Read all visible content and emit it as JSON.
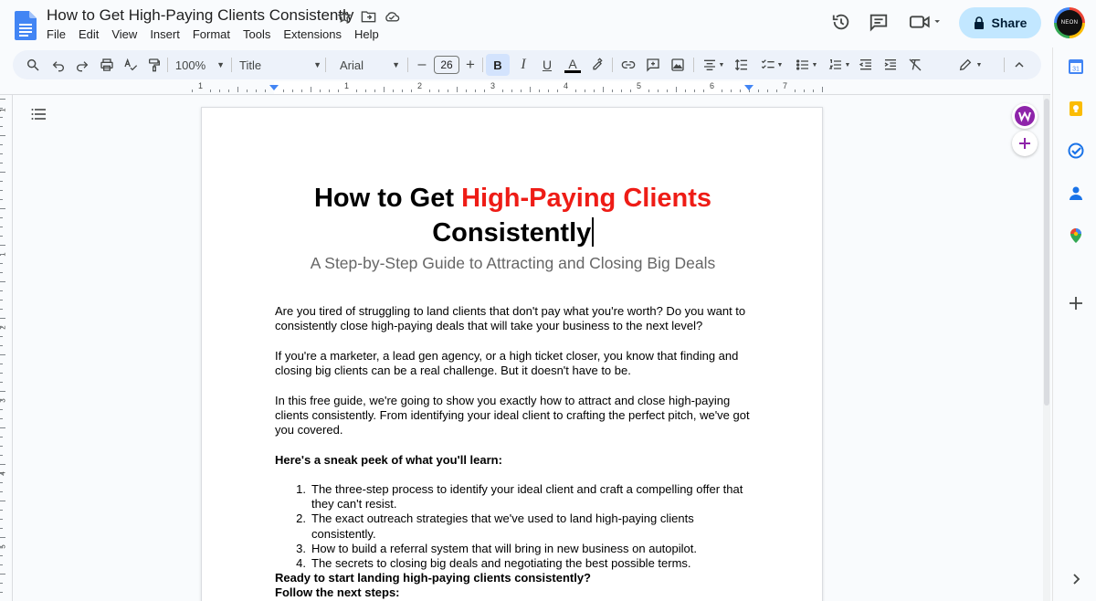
{
  "header": {
    "doc_title": "How to Get High-Paying Clients Consistently",
    "menu": [
      "File",
      "Edit",
      "View",
      "Insert",
      "Format",
      "Tools",
      "Extensions",
      "Help"
    ],
    "share_label": "Share",
    "avatar_text": "NEON"
  },
  "toolbar": {
    "zoom": "100%",
    "style": "Title",
    "font": "Arial",
    "font_size": "26",
    "bold": "B",
    "italic": "I",
    "underline": "U",
    "text_color": "A",
    "minus": "–",
    "plus": "+"
  },
  "ruler": {
    "numbers": [
      "1",
      "1",
      "2",
      "3",
      "4",
      "5",
      "6",
      "7"
    ]
  },
  "vruler": {
    "numbers": [
      "1",
      "1",
      "2",
      "3",
      "4",
      "5"
    ]
  },
  "document": {
    "title_part1": "How to Get ",
    "title_part2": "High-Paying Clients",
    "title_line2": "Consistently",
    "subtitle": "A Step-by-Step Guide to Attracting and Closing Big Deals",
    "para1": "Are you tired of struggling to land clients that don't pay what you're worth? Do you want to consistently close high-paying deals that will take your business to the next level?",
    "para2": "If you're a marketer, a lead gen agency, or a high ticket closer, you know that finding and closing big clients can be a real challenge. But it doesn't have to be.",
    "para3": "In this free guide, we're going to show you exactly how to attract and close high-paying clients consistently. From identifying your ideal client to crafting the perfect pitch, we've got you covered.",
    "sneak_peek": "Here's a sneak peek of what you'll learn:",
    "list": [
      {
        "num": "1.",
        "text": "The three-step process to identify your ideal client and craft a compelling offer that they can't resist."
      },
      {
        "num": "2.",
        "text": "The exact outreach strategies that we've used to land high-paying clients consistently."
      },
      {
        "num": "3.",
        "text": "How to build a referral system that will bring in new business on autopilot."
      },
      {
        "num": "4.",
        "text": "The secrets to closing big deals and negotiating the best possible terms."
      }
    ],
    "ready": "Ready to start landing high-paying clients consistently?",
    "follow": "Follow the next steps:"
  },
  "colors": {
    "accent_red": "#ee1c16",
    "share_bg": "#c2e7ff",
    "toolbar_bg": "#edf2fa"
  },
  "side_icons": [
    "calendar-icon",
    "keep-icon",
    "tasks-icon",
    "contacts-icon",
    "maps-icon",
    "add-icon"
  ]
}
